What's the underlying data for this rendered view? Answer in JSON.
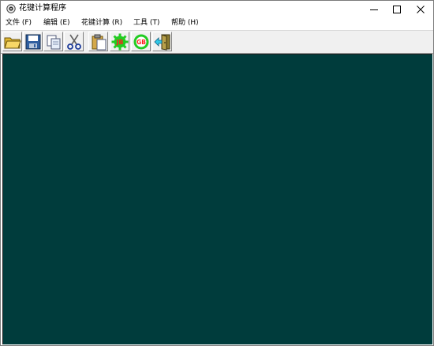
{
  "window": {
    "title": "花键计算程序",
    "icon": "gear-app-icon"
  },
  "controls": {
    "minimize_icon": "minimize-icon",
    "maximize_icon": "maximize-icon",
    "close_icon": "close-icon"
  },
  "menu": {
    "items": [
      {
        "label": "文件 (F)"
      },
      {
        "label": "编辑 (E)"
      },
      {
        "label": "花键计算 (R)"
      },
      {
        "label": "工具 (T)"
      },
      {
        "label": "帮助 (H)"
      }
    ]
  },
  "toolbar": {
    "buttons": [
      {
        "icon": "open-folder-icon"
      },
      {
        "icon": "save-icon"
      },
      {
        "icon": "copy-icon"
      },
      {
        "icon": "cut-icon"
      },
      {
        "icon": "paste-icon"
      },
      {
        "icon": "spline-gear-icon",
        "text": "JB"
      },
      {
        "icon": "gb-gear-icon",
        "text": "GB"
      },
      {
        "icon": "exit-door-icon"
      }
    ]
  },
  "colors": {
    "client_background": "#003c3c",
    "gear_green": "#22cc22"
  }
}
